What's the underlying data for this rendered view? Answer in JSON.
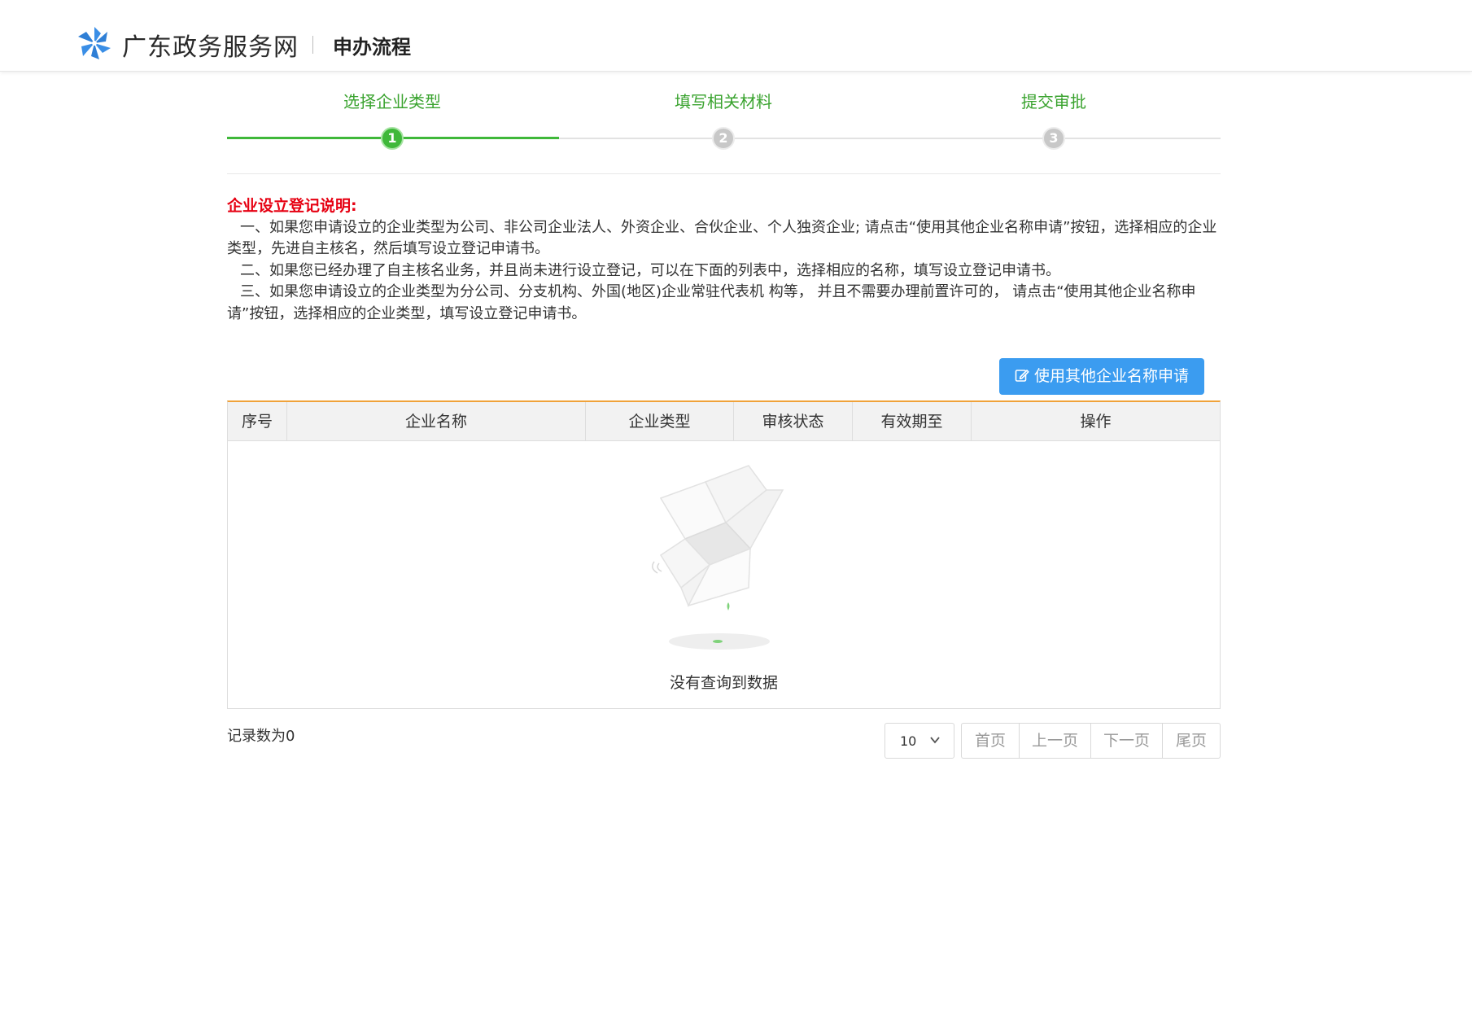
{
  "header": {
    "site_name": "广东政务服务网",
    "page_title": "申办流程",
    "logo_icon": "pinwheel-logo-icon",
    "brand_color": "#3a8ee6"
  },
  "steps": {
    "items": [
      {
        "label": "选择企业类型",
        "number": "1",
        "state": "active"
      },
      {
        "label": "填写相关材料",
        "number": "2",
        "state": "inactive"
      },
      {
        "label": "提交审批",
        "number": "3",
        "state": "inactive"
      }
    ],
    "active_color": "#3fb83a"
  },
  "notice": {
    "title": "企业设立登记说明:",
    "paragraphs": [
      "一、如果您申请设立的企业类型为公司、非公司企业法人、外资企业、合伙企业、个人独资企业; 请点击“使用其他企业名称申请”按钮，选择相应的企业类型，先进自主核名，然后填写设立登记申请书。",
      "二、如果您已经办理了自主核名业务，并且尚未进行设立登记，可以在下面的列表中，选择相应的名称，填写设立登记申请书。",
      "三、如果您申请设立的企业类型为分公司、分支机构、外国(地区)企业常驻代表机 构等， 并且不需要办理前置许可的， 请点击“使用其他企业名称申请”按钮，选择相应的企业类型，填写设立登记申请书。"
    ],
    "title_color": "#e60012"
  },
  "actions": {
    "use_other_name_label": "使用其他企业名称申请",
    "button_icon": "edit-icon",
    "button_color": "#3b9cf0"
  },
  "table": {
    "columns": [
      "序号",
      "企业名称",
      "企业类型",
      "审核状态",
      "有效期至",
      "操作"
    ],
    "empty_text": "没有查询到数据",
    "empty_icon": "empty-box-icon",
    "header_accent": "#f0a23a"
  },
  "footer": {
    "record_count": "记录数为0",
    "page_size": "10",
    "first": "首页",
    "prev": "上一页",
    "next": "下一页",
    "last": "尾页"
  }
}
